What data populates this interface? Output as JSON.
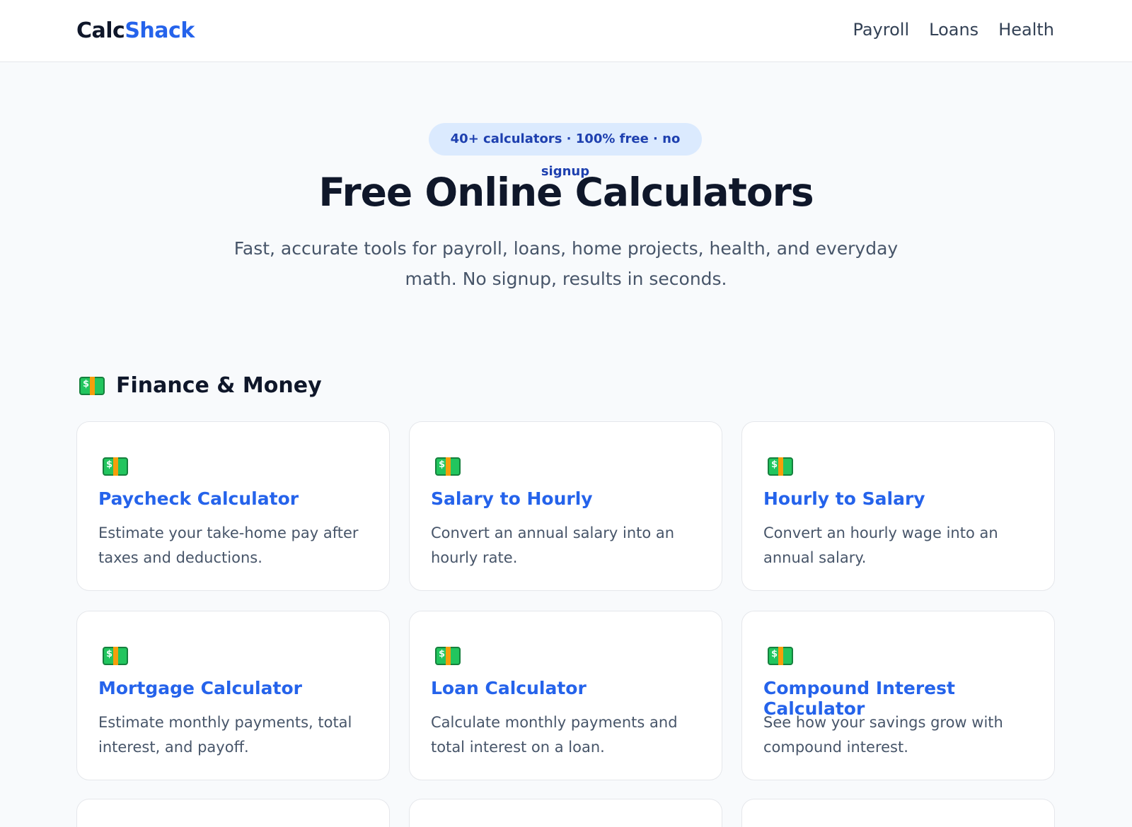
{
  "brand": {
    "part1": "Calc",
    "part2": "Shack"
  },
  "nav": {
    "items": [
      "Payroll",
      "Loans",
      "Health"
    ]
  },
  "hero": {
    "pill": "40+ calculators · 100% free · no signup",
    "title": "Free Online Calculators",
    "subtitle": "Fast, accurate tools for payroll, loans, home projects, health, and everyday math. No signup, results in seconds."
  },
  "section": {
    "title": "Finance & Money",
    "icon": "money-icon"
  },
  "cards": [
    {
      "title": "Paycheck Calculator",
      "desc": "Estimate your take-home pay after taxes and deductions.",
      "icon": "money-icon"
    },
    {
      "title": "Salary to Hourly",
      "desc": "Convert an annual salary into an hourly rate.",
      "icon": "money-icon"
    },
    {
      "title": "Hourly to Salary",
      "desc": "Convert an hourly wage into an annual salary.",
      "icon": "money-icon"
    },
    {
      "title": "Mortgage Calculator",
      "desc": "Estimate monthly payments, total interest, and payoff.",
      "icon": "money-icon"
    },
    {
      "title": "Loan Calculator",
      "desc": "Calculate monthly payments and total interest on a loan.",
      "icon": "money-icon"
    },
    {
      "title": "Compound Interest Calculator",
      "desc": "See how your savings grow with compound interest.",
      "icon": "money-icon"
    }
  ],
  "colors": {
    "accent": "#2563eb",
    "pill_bg": "#dbeafe",
    "page_bg": "#f8fafc"
  }
}
